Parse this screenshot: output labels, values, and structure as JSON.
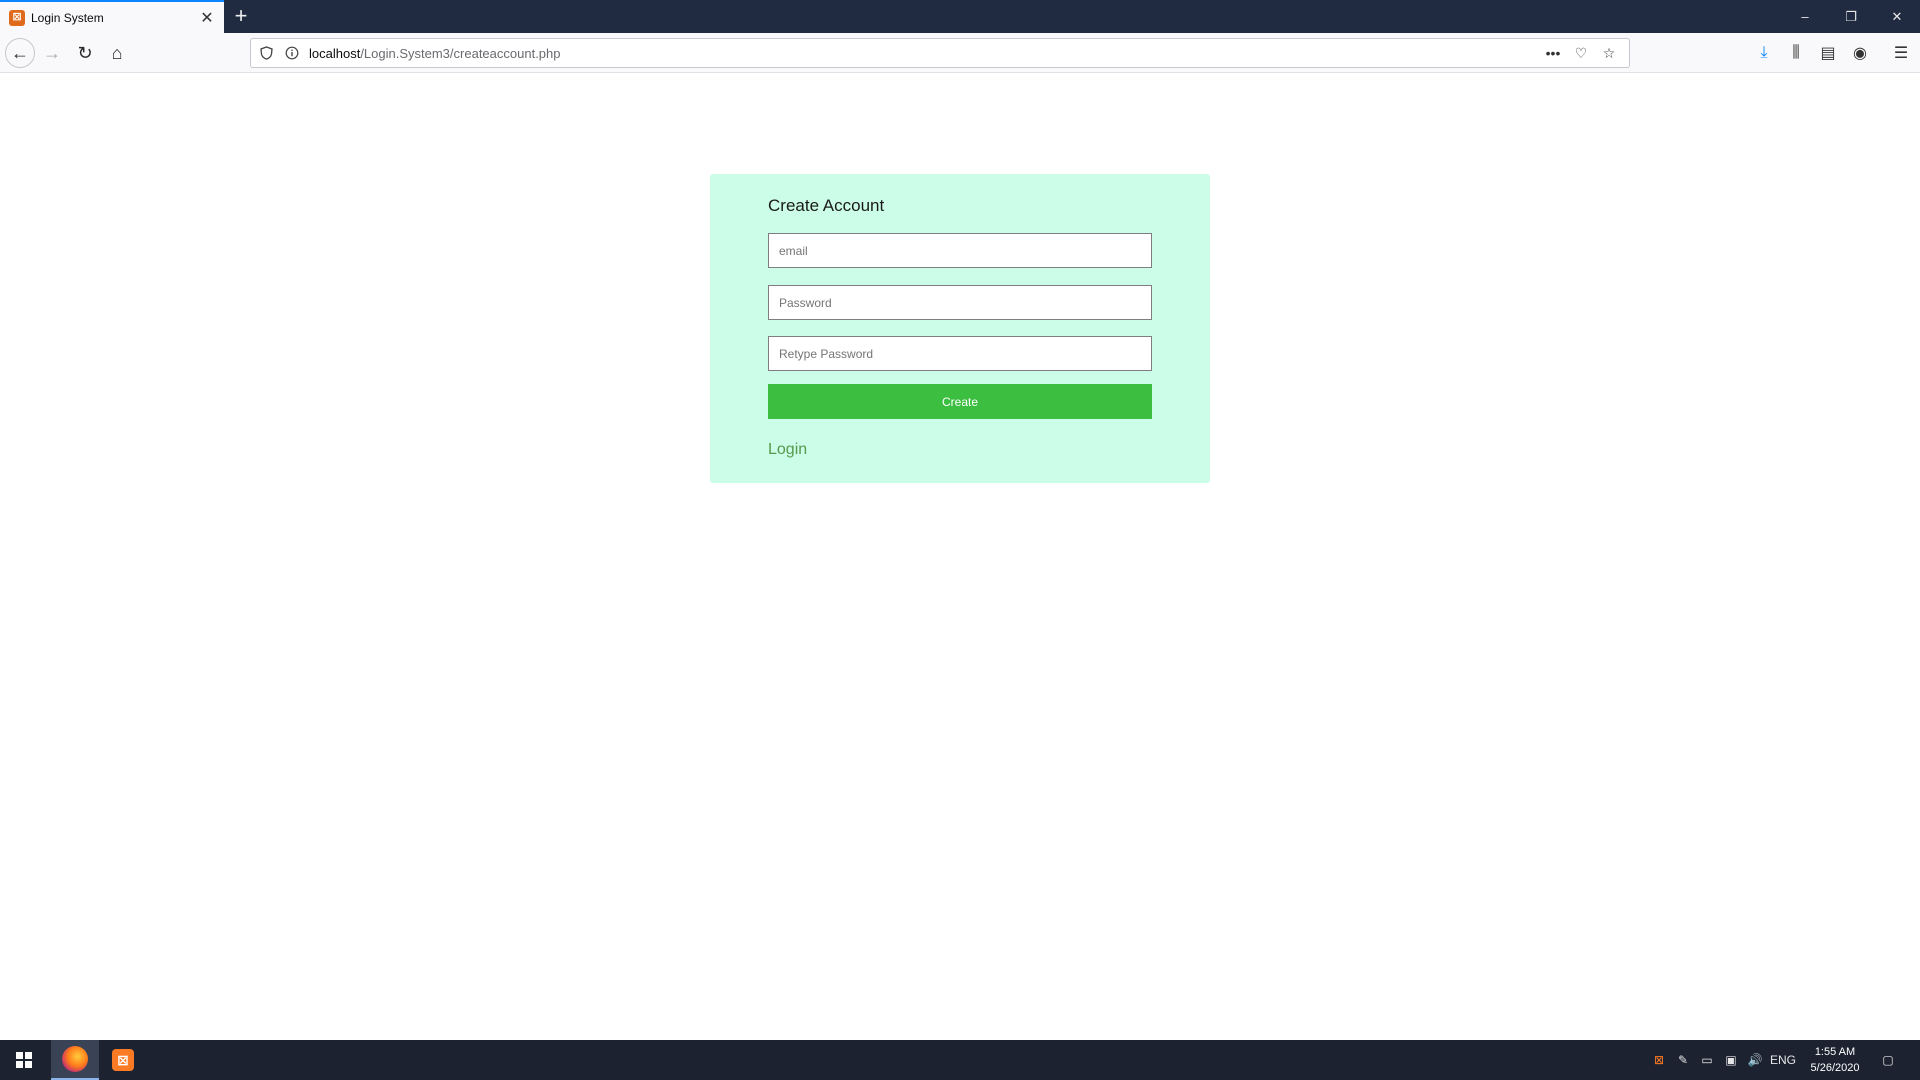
{
  "browser": {
    "tab": {
      "title": "Login System",
      "favicon_glyph": "⊠",
      "close_glyph": "✕"
    },
    "new_tab_glyph": "+",
    "window_controls": {
      "minimize": "–",
      "restore": "❐",
      "close": "✕"
    },
    "nav": {
      "back": "←",
      "forward": "→",
      "reload": "↻",
      "home": "⌂"
    },
    "url": {
      "host": "localhost",
      "path": "/Login.System3/createaccount.php"
    },
    "url_actions": {
      "more": "•••",
      "pocket": "♡",
      "bookmark": "☆"
    },
    "toolbar": {
      "download": "⤓",
      "library": "⫼",
      "sidebar": "▤",
      "account": "◉",
      "menu": "☰"
    }
  },
  "form": {
    "title": "Create Account",
    "email_placeholder": "email",
    "password_placeholder": "Password",
    "retype_placeholder": "Retype Password",
    "submit_label": "Create",
    "login_link": "Login"
  },
  "taskbar": {
    "xampp_glyph": "⊠",
    "tray": {
      "xampp": "⊠",
      "network_pen": "✎",
      "battery": "▭",
      "network": "▣",
      "volume": "🔊",
      "language": "ENG"
    },
    "time": "1:55 AM",
    "date": "5/26/2020",
    "notifications": "▢"
  },
  "colors": {
    "card_bg": "#ccfde9",
    "button_bg": "#3cbf41",
    "link": "#57994a",
    "tab_strip": "#202a40",
    "taskbar": "#1c2230"
  }
}
